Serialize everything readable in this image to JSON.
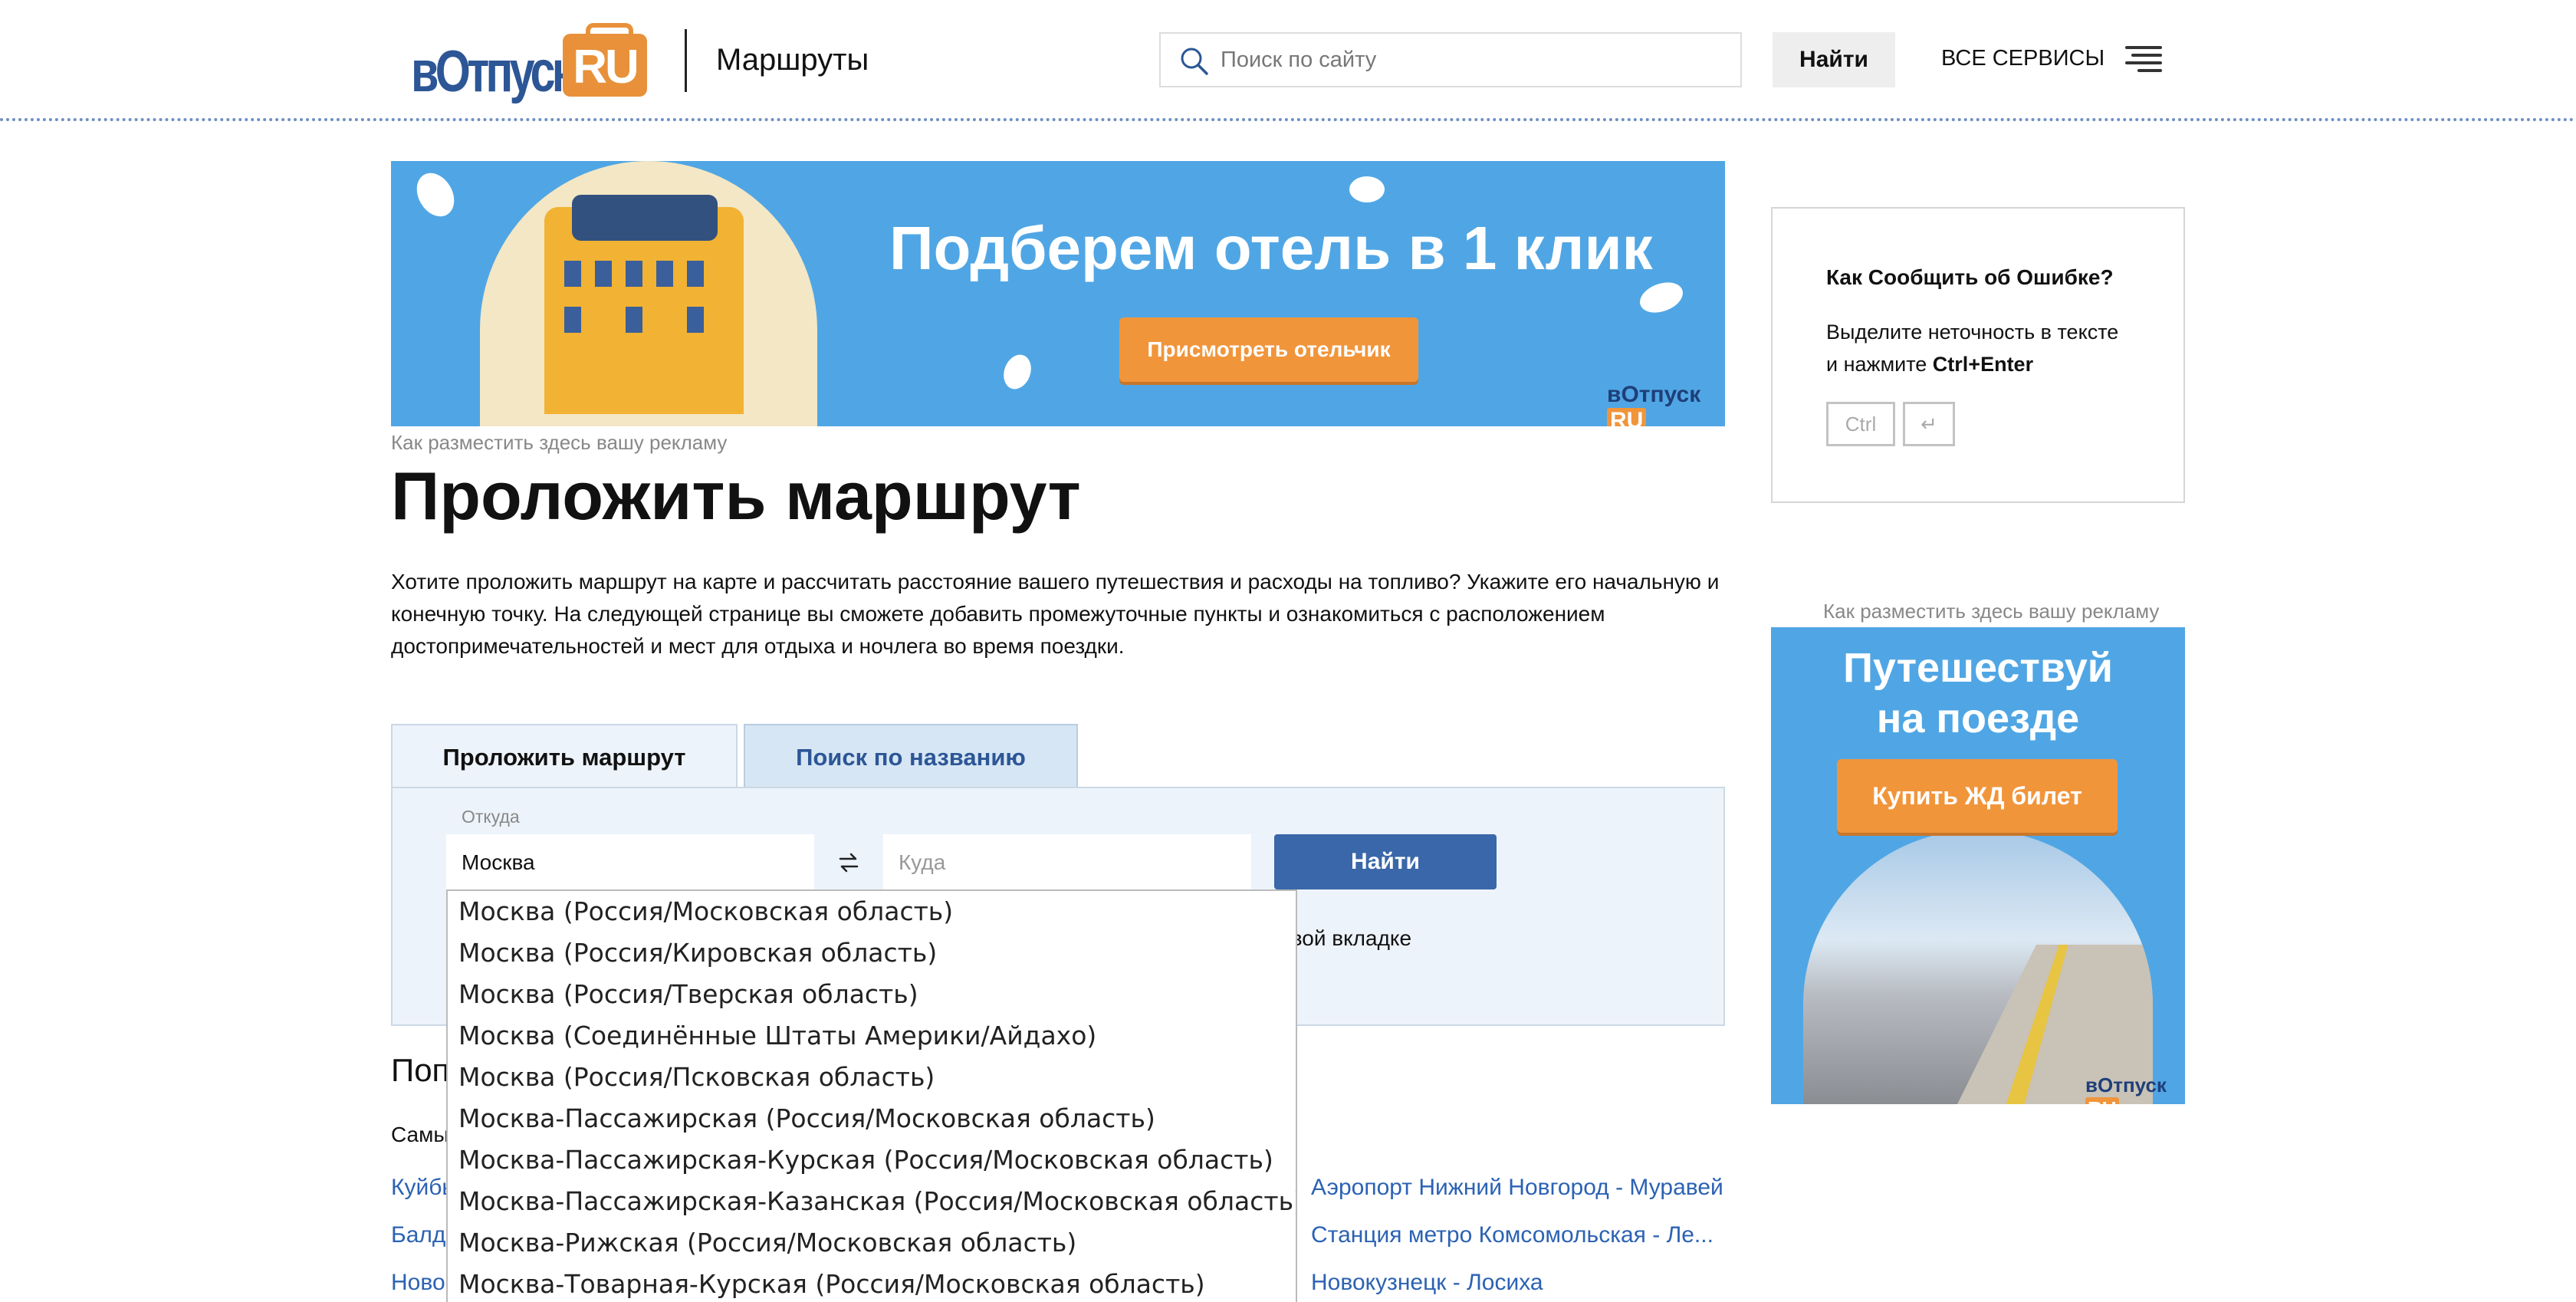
{
  "header": {
    "logo_text": "вОтпуск",
    "logo_badge": "RU",
    "section": "Маршруты",
    "search_placeholder": "Поиск по сайту",
    "search_button": "Найти",
    "all_services": "ВСЕ СЕРВИСЫ"
  },
  "banner": {
    "title": "Подберем отель в 1 клик",
    "button": "Присмотреть отельчик",
    "logo_text": "вОтпуск",
    "logo_badge": "RU"
  },
  "ad_link": "Как разместить здесь вашу рекламу",
  "page": {
    "title": "Проложить маршрут",
    "intro": "Хотите проложить маршрут на карте и рассчитать расстояние вашего путешествия и расходы на топливо? Укажите его начальную и конечную точку. На следующей странице вы сможете добавить промежуточные пункты и ознакомиться с расположением достопримечательностей и мест для отдыха и ночлега во время поездки."
  },
  "form": {
    "tabs": [
      {
        "label": "Проложить маршрут",
        "active": true
      },
      {
        "label": "Поиск по названию",
        "active": false
      }
    ],
    "from_label": "Откуда",
    "from_value": "Москва",
    "to_placeholder": "Куда",
    "submit": "Найти",
    "newtab_text": "в новой вкладке"
  },
  "dropdown": [
    "Москва (Россия/Московская область)",
    "Москва (Россия/Кировская область)",
    "Москва (Россия/Тверская область)",
    "Москва (Соединённые Штаты Америки/Айдахо)",
    "Москва (Россия/Псковская область)",
    "Москва-Пассажирская (Россия/Московская область)",
    "Москва-Пассажирская-Курская (Россия/Московская область)",
    "Москва-Пассажирская-Казанская (Россия/Московская область)",
    "Москва-Рижская (Россия/Московская область)",
    "Москва-Товарная-Курская (Россия/Московская область)"
  ],
  "popular": {
    "title_partial": "Поп",
    "most_partial": "Самы",
    "left_links": [
      "Куйбы",
      "Балд",
      "Ново"
    ],
    "right_links": [
      "Аэропорт Нижний Новгород - Муравей",
      "Станция метро Комсомольская - Ле...",
      "Новокузнецк - Лосиха"
    ]
  },
  "sidebar": {
    "error_title": "Как Сообщить об Ошибке?",
    "error_text_1": "Выделите неточность в тексте",
    "error_text_2": "и нажмите ",
    "error_keys": "Ctrl+Enter",
    "key_ctrl": "Ctrl",
    "key_enter": "↵",
    "ad_link": "Как разместить здесь вашу рекламу",
    "ad_title_1": "Путешествуй",
    "ad_title_2": "на поезде",
    "ad_button": "Купить ЖД билет",
    "ad_logo_text": "вОтпуск",
    "ad_logo_badge": "RU"
  },
  "colors": {
    "brand_blue": "#2c5696",
    "brand_orange": "#e8913a",
    "banner_blue": "#50a6e4",
    "link_blue": "#2b62b3",
    "button_blue": "#3a67a9"
  }
}
